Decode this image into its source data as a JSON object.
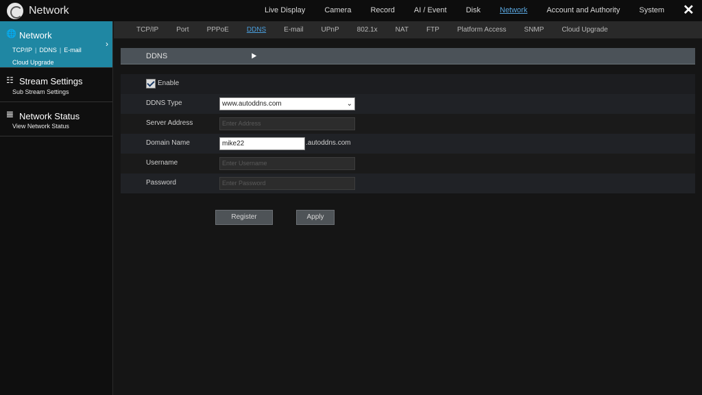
{
  "app": {
    "title": "Network"
  },
  "topnav": {
    "items": [
      "Live Display",
      "Camera",
      "Record",
      "AI / Event",
      "Disk",
      "Network",
      "Account and Authority",
      "System"
    ],
    "active_index": 5
  },
  "sidebar": {
    "network": {
      "title": "Network",
      "links": [
        "TCP/IP",
        "DDNS",
        "E-mail"
      ],
      "extra": "Cloud Upgrade"
    },
    "stream": {
      "title": "Stream Settings",
      "sub": "Sub Stream Settings"
    },
    "status": {
      "title": "Network Status",
      "sub": "View Network Status"
    }
  },
  "subtabs": {
    "items": [
      "TCP/IP",
      "Port",
      "PPPoE",
      "DDNS",
      "E-mail",
      "UPnP",
      "802.1x",
      "NAT",
      "FTP",
      "Platform Access",
      "SNMP",
      "Cloud Upgrade"
    ],
    "active_index": 3
  },
  "section": {
    "title": "DDNS"
  },
  "form": {
    "enable_label": "Enable",
    "enabled": true,
    "ddns_type_label": "DDNS Type",
    "ddns_type_value": "www.autoddns.com",
    "server_address_label": "Server Address",
    "server_address_placeholder": "Enter Address",
    "domain_name_label": "Domain Name",
    "domain_name_value": "mike22",
    "domain_suffix": ".autoddns.com",
    "username_label": "Username",
    "username_placeholder": "Enter Username",
    "password_label": "Password",
    "password_placeholder": "Enter Password"
  },
  "buttons": {
    "register": "Register",
    "apply": "Apply"
  }
}
